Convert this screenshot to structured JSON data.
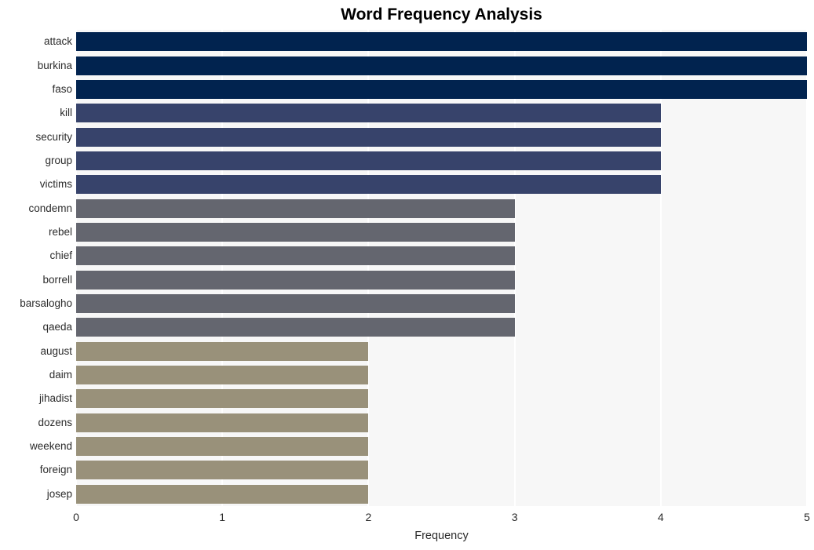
{
  "chart_data": {
    "type": "bar",
    "orientation": "horizontal",
    "title": "Word Frequency Analysis",
    "xlabel": "Frequency",
    "ylabel": "",
    "categories": [
      "attack",
      "burkina",
      "faso",
      "kill",
      "security",
      "group",
      "victims",
      "condemn",
      "rebel",
      "chief",
      "borrell",
      "barsalogho",
      "qaeda",
      "august",
      "daim",
      "jihadist",
      "dozens",
      "weekend",
      "foreign",
      "josep"
    ],
    "values": [
      5,
      5,
      5,
      4,
      4,
      4,
      4,
      3,
      3,
      3,
      3,
      3,
      3,
      2,
      2,
      2,
      2,
      2,
      2,
      2
    ],
    "bar_colors": [
      "#01234f",
      "#01234f",
      "#01234f",
      "#37436b",
      "#37436b",
      "#37436b",
      "#37436b",
      "#64666f",
      "#64666f",
      "#64666f",
      "#64666f",
      "#64666f",
      "#64666f",
      "#99917a",
      "#99917a",
      "#99917a",
      "#99917a",
      "#99917a",
      "#99917a",
      "#99917a"
    ],
    "xlim": [
      0,
      5
    ],
    "xticks": [
      "0",
      "1",
      "2",
      "3",
      "4",
      "5"
    ],
    "grid": true,
    "grid_axis": "x",
    "grid_color": "#ffffff",
    "plot_background": "#f7f7f7",
    "figure_background": "#ffffff",
    "legend": "none"
  },
  "palette": {
    "freq_5": "#01234f",
    "freq_4": "#37436b",
    "freq_3": "#64666f",
    "freq_2": "#99917a",
    "text": "#2b2b2b",
    "title_text": "#000000"
  }
}
